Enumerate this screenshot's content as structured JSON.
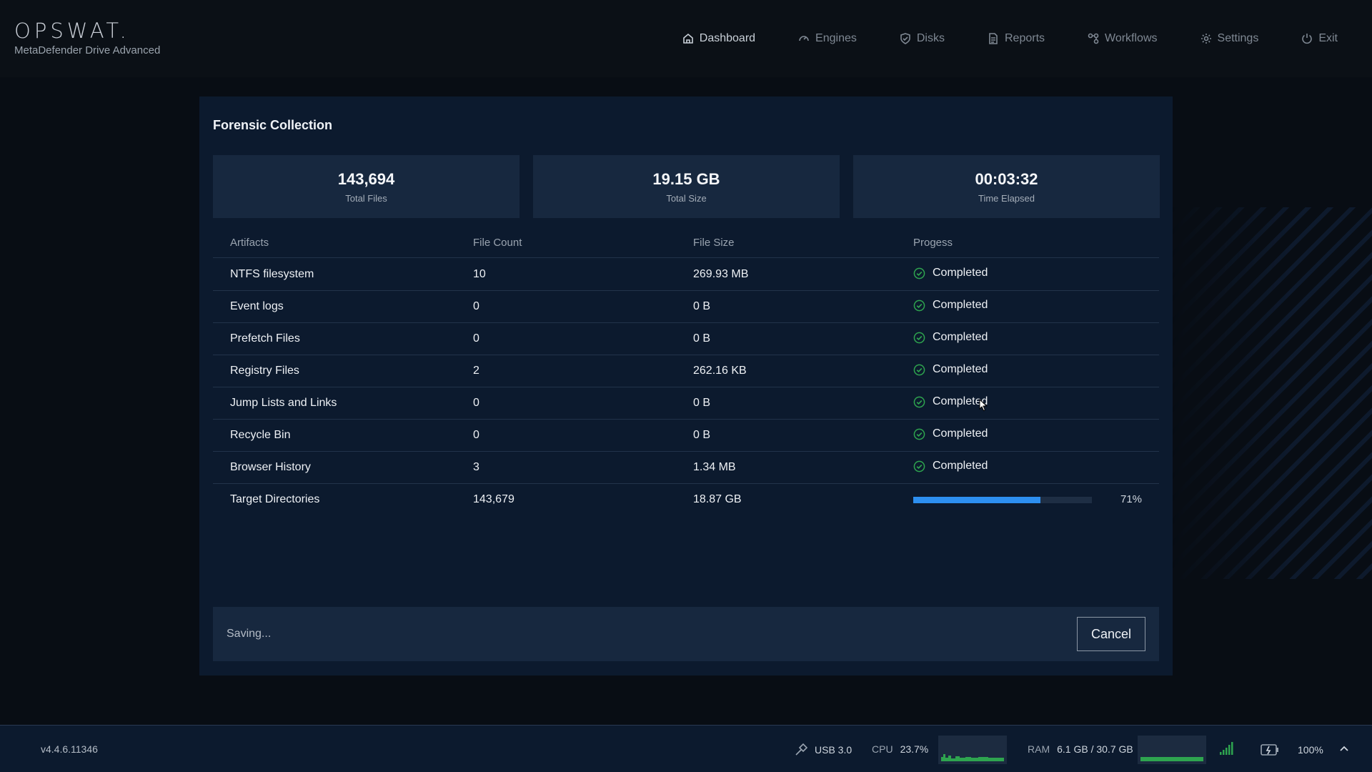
{
  "header": {
    "logo": "OPSWAT.",
    "product": "MetaDefender Drive Advanced",
    "nav": [
      {
        "label": "Dashboard",
        "icon": "home-icon",
        "active": true
      },
      {
        "label": "Engines",
        "icon": "gauge-icon",
        "active": false
      },
      {
        "label": "Disks",
        "icon": "shield-check-icon",
        "active": false
      },
      {
        "label": "Reports",
        "icon": "document-icon",
        "active": false
      },
      {
        "label": "Workflows",
        "icon": "workflow-icon",
        "active": false
      },
      {
        "label": "Settings",
        "icon": "gear-icon",
        "active": false
      },
      {
        "label": "Exit",
        "icon": "power-icon",
        "active": false
      }
    ]
  },
  "panel": {
    "title": "Forensic Collection",
    "stats": [
      {
        "value": "143,694",
        "label": "Total Files"
      },
      {
        "value": "19.15 GB",
        "label": "Total Size"
      },
      {
        "value": "00:03:32",
        "label": "Time Elapsed"
      }
    ],
    "columns": [
      "Artifacts",
      "File Count",
      "File Size",
      "Progess"
    ],
    "rows": [
      {
        "artifact": "NTFS filesystem",
        "count": "10",
        "size": "269.93 MB",
        "status": "Completed"
      },
      {
        "artifact": "Event logs",
        "count": "0",
        "size": "0 B",
        "status": "Completed"
      },
      {
        "artifact": "Prefetch Files",
        "count": "0",
        "size": "0 B",
        "status": "Completed"
      },
      {
        "artifact": "Registry Files",
        "count": "2",
        "size": "262.16 KB",
        "status": "Completed"
      },
      {
        "artifact": "Jump Lists and Links",
        "count": "0",
        "size": "0 B",
        "status": "Completed"
      },
      {
        "artifact": "Recycle Bin",
        "count": "0",
        "size": "0 B",
        "status": "Completed"
      },
      {
        "artifact": "Browser History",
        "count": "3",
        "size": "1.34 MB",
        "status": "Completed"
      },
      {
        "artifact": "Target Directories",
        "count": "143,679",
        "size": "18.87 GB",
        "progress": 0.71,
        "progress_label": "71%"
      }
    ],
    "footer": {
      "status": "Saving...",
      "cancel_label": "Cancel"
    }
  },
  "statusbar": {
    "version": "v4.4.6.11346",
    "usb": "USB 3.0",
    "cpu_label": "CPU",
    "cpu_value": "23.7%",
    "ram_label": "RAM",
    "ram_value": "6.1 GB / 30.7 GB",
    "battery": "100%"
  },
  "colors": {
    "accent": "#2d8ff0",
    "success": "#2ea44f",
    "panel": "#0c1a2e",
    "card": "#17283f"
  }
}
